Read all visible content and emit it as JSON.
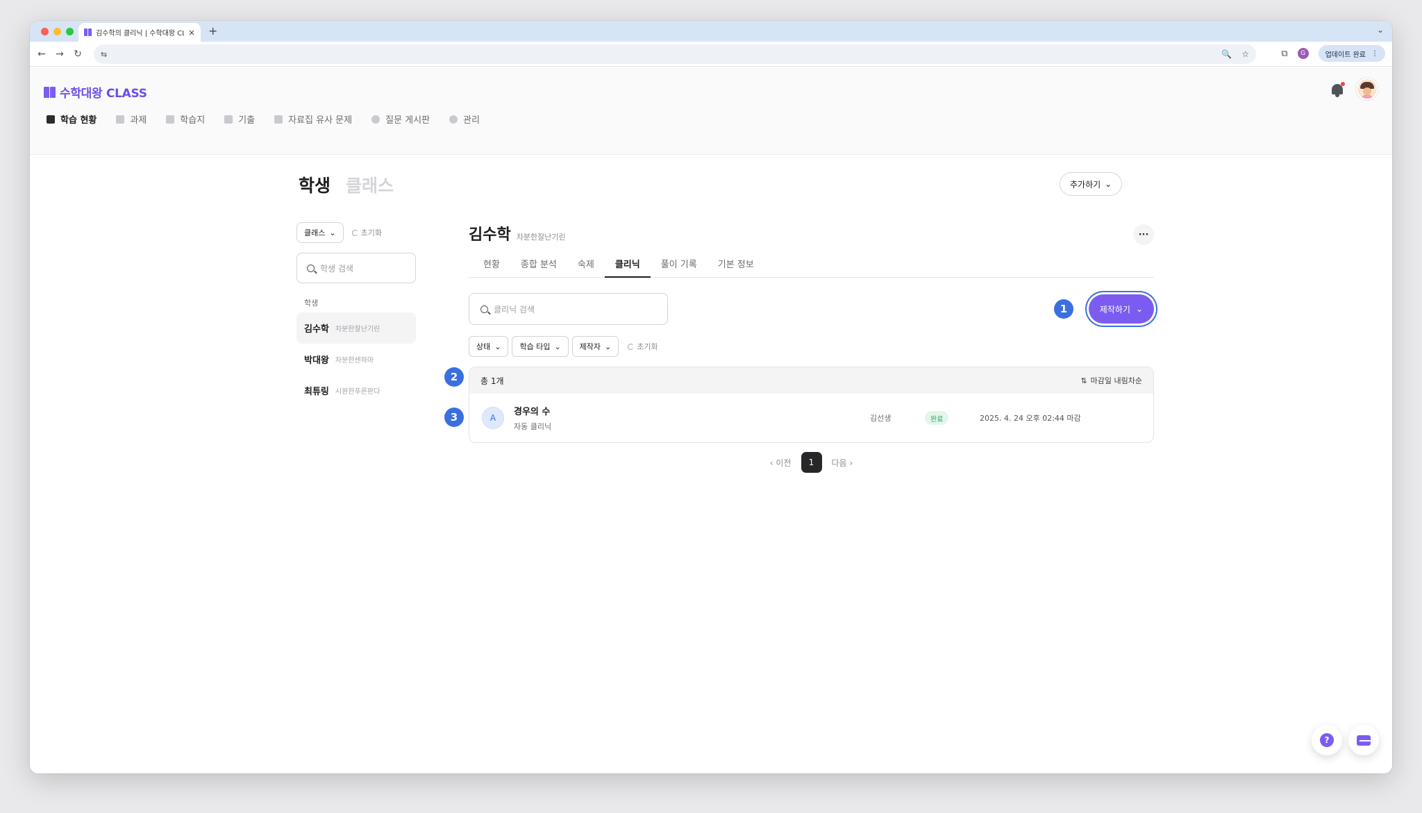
{
  "browser": {
    "tab_title": "김수학의 클리닉 | 수학대왕 CLASS",
    "tab_close": "×",
    "new_tab": "+",
    "tab_menu": "⌄",
    "back": "←",
    "forward": "→",
    "reload": "↻",
    "site_info": "⇆",
    "zoom": "🔍",
    "bookmark": "☆",
    "extensions": "⧉",
    "profile_initial": "G",
    "update_label": "업데이트 완료",
    "update_menu": "⋮"
  },
  "app": {
    "logo_text": "수학대왕 CLASS",
    "nav": [
      {
        "label": "학습 현황",
        "icon": "graduation-cap-icon"
      },
      {
        "label": "과제",
        "icon": "document-icon"
      },
      {
        "label": "학습지",
        "icon": "worksheet-icon"
      },
      {
        "label": "기출",
        "icon": "stack-icon"
      },
      {
        "label": "자료집 유사 문제",
        "icon": "folder-icon"
      },
      {
        "label": "질문 게시판",
        "icon": "chat-icon"
      },
      {
        "label": "관리",
        "icon": "gear-icon"
      }
    ]
  },
  "page": {
    "title_active": "학생",
    "title_inactive": "클래스",
    "add_button": "추가하기"
  },
  "sidebar": {
    "class_select": "클래스",
    "reset": "초기화",
    "search_placeholder": "학생 검색",
    "section_label": "학생",
    "students": [
      {
        "name": "김수학",
        "sub": "차분한잘난기린"
      },
      {
        "name": "박대왕",
        "sub": "차분한센하마"
      },
      {
        "name": "최튜링",
        "sub": "시원한푸른판다"
      }
    ]
  },
  "detail": {
    "name": "김수학",
    "sub": "차분한잘난기린",
    "more": "···",
    "tabs": [
      "현황",
      "종합 분석",
      "숙제",
      "클리닉",
      "풀이 기록",
      "기본 정보"
    ],
    "clinic_search_placeholder": "클리닉 검색",
    "make_button": "제작하기",
    "filters": [
      "상태",
      "학습 타입",
      "제작자"
    ],
    "filter_reset": "초기화",
    "total": "총 1개",
    "sort": "마감일 내림차순",
    "rows": [
      {
        "avatar": "A",
        "title": "경우의 수",
        "sub": "자동 클리닉",
        "owner": "김선생",
        "status": "완료",
        "due": "2025. 4. 24 오후 02:44 마감"
      }
    ],
    "pager": {
      "prev": "이전",
      "current": "1",
      "next": "다음"
    }
  },
  "steps": [
    "1",
    "2",
    "3"
  ],
  "fab": {
    "help": "?"
  },
  "colors": {
    "brand": "#7c5cf0",
    "step_badge": "#3b6fe0",
    "status_done_bg": "#e3f6ea",
    "status_done_text": "#2ea66a"
  }
}
